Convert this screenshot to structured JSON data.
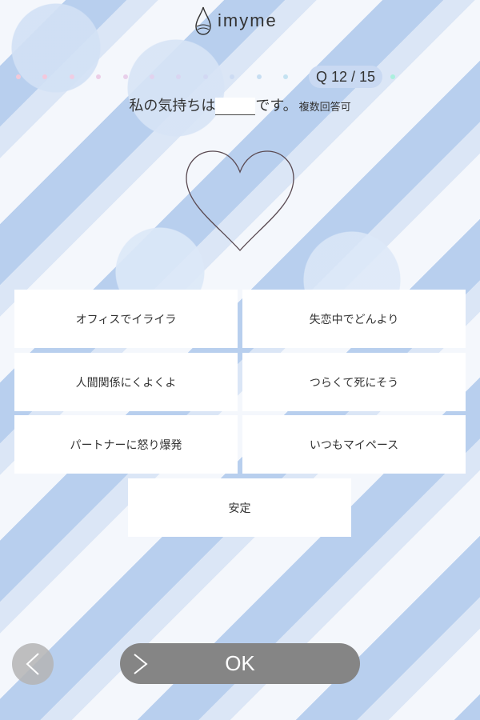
{
  "header": {
    "logo_text": "imyme",
    "logo_icon": "drop-icon"
  },
  "progress": {
    "current": 12,
    "total": 15,
    "label": "Q 12 / 15",
    "dot_colors": [
      "#f3c8d8",
      "#f3c8dc",
      "#efcde3",
      "#eccde6",
      "#e8cfea",
      "#e2d2ee",
      "#dad5f1",
      "#d2d8f3",
      "#ccdbf3",
      "#c7def2",
      "#c4e2f1",
      "#bfe6ef",
      "#b9eaeb",
      "#b2ede6",
      "#aaf0de"
    ]
  },
  "question": {
    "prefix": "私の気持ちは",
    "suffix": "です。",
    "note": "複数回答可"
  },
  "heart_icon": "heart-outline-icon",
  "options": [
    {
      "label": "オフィスでイライラ"
    },
    {
      "label": "失恋中でどんより"
    },
    {
      "label": "人間関係にくよくよ"
    },
    {
      "label": "つらくて死にそう"
    },
    {
      "label": "パートナーに怒り爆発"
    },
    {
      "label": "いつもマイペース"
    },
    {
      "label": "安定"
    }
  ],
  "footer": {
    "ok_label": "OK",
    "back_icon": "chevron-left-icon",
    "ok_icon": "chevron-right-icon"
  },
  "colors": {
    "ok_button": "#858585",
    "badge": "#c9d9f2",
    "heart_stroke": "#5a4a52"
  }
}
